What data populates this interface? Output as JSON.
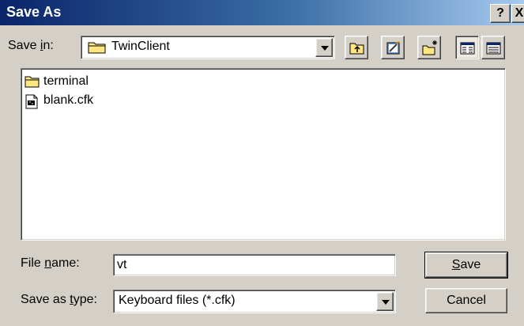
{
  "dialog": {
    "title": "Save As",
    "help_label": "?",
    "close_label": "X"
  },
  "save_in": {
    "label_prefix": "Save ",
    "label_accel": "i",
    "label_suffix": "n:",
    "folder": "TwinClient",
    "folder_icon": "folder-icon"
  },
  "toolbar": {
    "buttons": [
      {
        "name": "up-one-level",
        "icon": "folder-up-icon"
      },
      {
        "name": "desktop",
        "icon": "desktop-icon"
      },
      {
        "name": "new-folder",
        "icon": "new-folder-icon"
      },
      {
        "name": "list-view",
        "icon": "list-view-icon",
        "pressed": true
      },
      {
        "name": "details-view",
        "icon": "details-view-icon"
      }
    ]
  },
  "files": [
    {
      "name": "terminal",
      "icon": "folder-icon"
    },
    {
      "name": "blank.cfk",
      "icon": "keyboard-file-icon"
    }
  ],
  "file_name": {
    "label_prefix": "File ",
    "label_accel": "n",
    "label_suffix": "ame:",
    "value": "vt"
  },
  "save_as_type": {
    "label_prefix": "Save as ",
    "label_accel": "t",
    "label_suffix": "ype:",
    "value": "Keyboard files (*.cfk)"
  },
  "buttons": {
    "save_accel": "S",
    "save_rest": "ave",
    "cancel": "Cancel"
  },
  "colors": {
    "titlebar_start": "#0a246a",
    "titlebar_end": "#a6caf0",
    "face": "#d4d0c8",
    "folder": "#ffe680"
  }
}
